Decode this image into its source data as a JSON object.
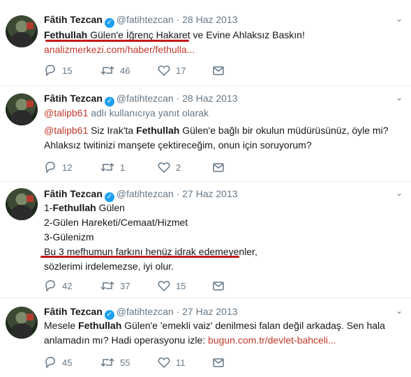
{
  "tweets": [
    {
      "name": "Fâtih Tezcan",
      "handle": "@fatihtezcan",
      "date": "· 28 Haz 2013",
      "lines": [
        {
          "p1_bold": "Fethullah",
          "p2": " Gülen'e İğrenç Hakaret ve Evine Ahlaksız Baskın!"
        },
        {
          "link": "analizmerkezi.com/haber/fethulla..."
        }
      ],
      "replies": "15",
      "retweets": "46",
      "likes": "17"
    },
    {
      "name": "Fâtih Tezcan",
      "handle": "@fatihtezcan",
      "date": "· 28 Haz 2013",
      "reply_to_mention": "@talipb61",
      "reply_to_text": " adlı kullanıcıya yanıt olarak",
      "lines": [
        {
          "mention": "@talipb61",
          "p1": " Siz Irak'ta ",
          "bold": "Fethullah",
          "p2": " Gülen'e bağlı bir okulun müdürüsünüz, öyle mi?"
        },
        {
          "p1": "Ahlaksız twitinizi manşete çektireceğim, onun için soruyorum?"
        }
      ],
      "replies": "12",
      "retweets": "1",
      "likes": "2"
    },
    {
      "name": "Fâtih Tezcan",
      "handle": "@fatihtezcan",
      "date": "· 27 Haz 2013",
      "lines": [
        {
          "p1": "1-",
          "bold": "Fethullah",
          "p2": " Gülen"
        },
        {
          "p1": "2-Gülen Hareketi/Cemaat/Hizmet"
        },
        {
          "p1": "3-Gülenizm"
        },
        {
          "p1": "Bu 3 mefhumun farkını henüz idrak edemeyenler,"
        },
        {
          "p1": "sözlerimi irdelemezse, iyi olur."
        }
      ],
      "replies": "42",
      "retweets": "37",
      "likes": "15"
    },
    {
      "name": "Fâtih Tezcan",
      "handle": "@fatihtezcan",
      "date": "· 27 Haz 2013",
      "lines": [
        {
          "p1": "Mesele ",
          "bold": "Fethullah",
          "p2": " Gülen'e 'emekli vaiz' denilmesi falan değil arkadaş. Sen hala"
        },
        {
          "p1": "anlamadın mı? Hadi operasyonu izle: ",
          "link": "bugun.com.tr/devlet-bahceli..."
        }
      ],
      "replies": "45",
      "retweets": "55",
      "likes": "11"
    }
  ]
}
